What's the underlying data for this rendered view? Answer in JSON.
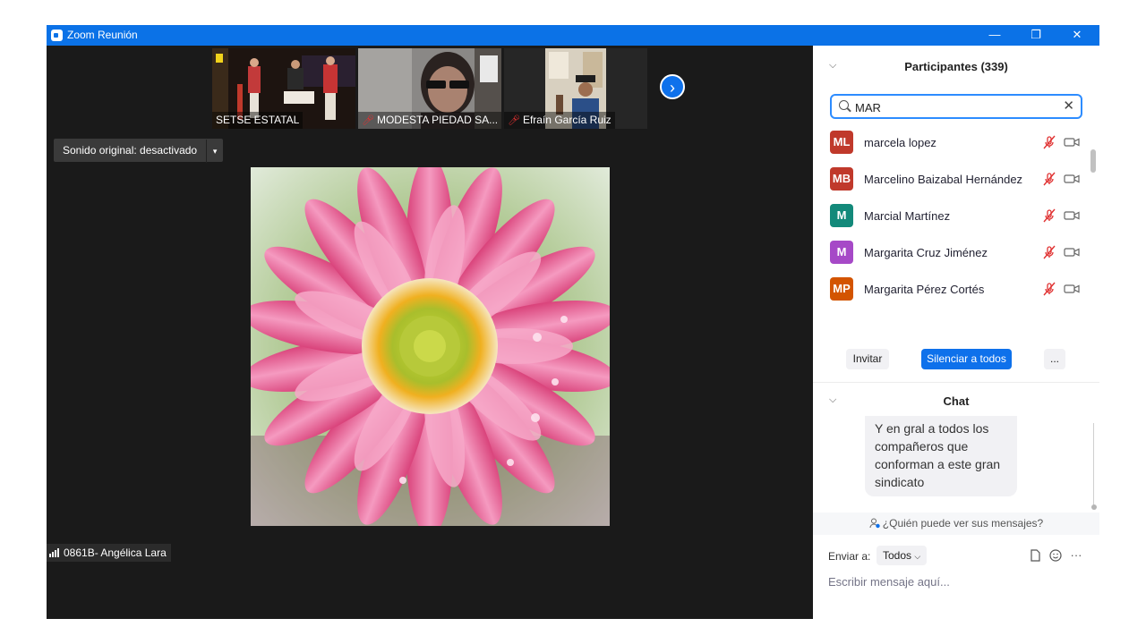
{
  "window": {
    "title": "Zoom Reunión",
    "controls": {
      "minimize": "—",
      "restore": "❐",
      "close": "✕"
    }
  },
  "videos": {
    "thumbnails": [
      {
        "name": "SETSE ESTATAL",
        "muted": false
      },
      {
        "name": "MODESTA PIEDAD SA...",
        "muted": true
      },
      {
        "name": "Efraín García Ruiz",
        "muted": true
      }
    ],
    "next_label": "›",
    "sound_button": {
      "label": "Sonido original: desactivado",
      "arrow": "▾"
    },
    "speaker_name": "0861B- Angélica Lara"
  },
  "participants": {
    "collapse_icon": "chevron-down-icon",
    "title": "Participantes (339)",
    "search": {
      "value": "MAR",
      "placeholder": ""
    },
    "list": [
      {
        "initials": "ML",
        "name": "marcela lopez",
        "color": "#c0392b"
      },
      {
        "initials": "MB",
        "name": "Marcelino Baizabal Hernández",
        "color": "#c0392b"
      },
      {
        "initials": "M",
        "name": "Marcial Martínez",
        "color": "#13897a"
      },
      {
        "initials": "M",
        "name": "Margarita Cruz Jiménez",
        "color": "#a649c7"
      },
      {
        "initials": "MP",
        "name": "Margarita Pérez Cortés",
        "color": "#d35400"
      }
    ],
    "actions": {
      "invite": "Invitar",
      "mute_all": "Silenciar a todos",
      "more": "..."
    }
  },
  "chat": {
    "title": "Chat",
    "message": "Y en gral a todos los compañeros que conforman a este gran sindicato",
    "who_can_see": "¿Quién puede ver sus mensajes?",
    "send_to_label": "Enviar a:",
    "send_to_value": "Todos",
    "more": "···",
    "input_placeholder": "Escribir mensaje aquí..."
  },
  "colors": {
    "title_bar": "#0b72e7",
    "accent": "#0e71eb",
    "muted_icon": "#e03131"
  }
}
